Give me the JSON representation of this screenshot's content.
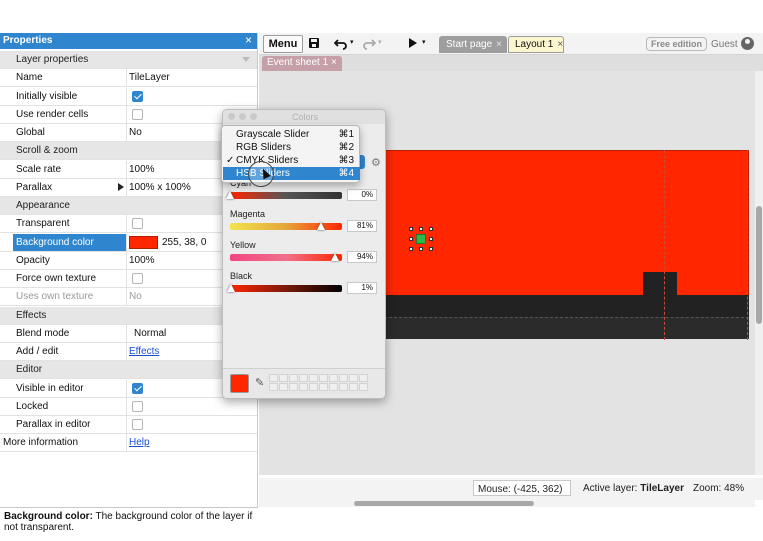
{
  "properties": {
    "title": "Properties",
    "close_label": "×",
    "rows": [
      {
        "type": "section",
        "label": "Layer properties"
      },
      {
        "type": "text",
        "label": "Name",
        "value": "TileLayer"
      },
      {
        "type": "check",
        "label": "Initially visible",
        "checked": true
      },
      {
        "type": "check",
        "label": "Use render cells",
        "checked": false
      },
      {
        "type": "text",
        "label": "Global",
        "value": "No"
      },
      {
        "type": "section",
        "label": "Scroll & zoom"
      },
      {
        "type": "text",
        "label": "Scale rate",
        "value": "100%"
      },
      {
        "type": "text",
        "label": "Parallax",
        "value": "100% x 100%"
      },
      {
        "type": "section",
        "label": "Appearance"
      },
      {
        "type": "check",
        "label": "Transparent",
        "checked": false
      },
      {
        "type": "color",
        "label": "Background color",
        "value": "255, 38, 0"
      },
      {
        "type": "text",
        "label": "Opacity",
        "value": "100%"
      },
      {
        "type": "check",
        "label": "Force own texture",
        "checked": false
      },
      {
        "type": "text",
        "label": "Uses own texture",
        "value": "No"
      },
      {
        "type": "section",
        "label": "Effects"
      },
      {
        "type": "text",
        "label": "Blend mode",
        "value": "Normal"
      },
      {
        "type": "link",
        "label": "Add / edit",
        "value": "Effects"
      },
      {
        "type": "section",
        "label": "Editor"
      },
      {
        "type": "check",
        "label": "Visible in editor",
        "checked": true
      },
      {
        "type": "check",
        "label": "Locked",
        "checked": false
      },
      {
        "type": "check",
        "label": "Parallax in editor",
        "checked": false
      },
      {
        "type": "link",
        "label": "More information",
        "value": "Help"
      }
    ],
    "footer_title": "Background color:",
    "footer_text": " The background color of the layer if not transparent."
  },
  "toolbar": {
    "menu_label": "Menu",
    "tabs": [
      {
        "label": "Start page",
        "close": "×"
      },
      {
        "label": "Layout 1",
        "close": "×"
      }
    ],
    "free_edition_label": "Free edition",
    "user_label": "Guest"
  },
  "subtabs": [
    {
      "label": "Event sheet 1",
      "close": "×"
    }
  ],
  "colors_panel": {
    "title": "Colors",
    "sliders": [
      {
        "label": "Cyan",
        "value": "0%",
        "fraction": 0.0,
        "gradient": "linear-gradient(to right, #ff2600, #555, #333)"
      },
      {
        "label": "Magenta",
        "value": "81%",
        "fraction": 0.81,
        "gradient": "linear-gradient(to right, #f3e34f, #e4a63a, #ff2600)"
      },
      {
        "label": "Yellow",
        "value": "94%",
        "fraction": 0.94,
        "gradient": "linear-gradient(to right, #f24680, #f0708a, #ff2600)"
      },
      {
        "label": "Black",
        "value": "1%",
        "fraction": 0.01,
        "gradient": "linear-gradient(to right, #ff2600, #7a1a0a, #000)"
      }
    ]
  },
  "dropdown": {
    "items": [
      {
        "label": "Grayscale Slider",
        "shortcut": "⌘1",
        "checked": false,
        "highlighted": false
      },
      {
        "label": "RGB Sliders",
        "shortcut": "⌘2",
        "checked": false,
        "highlighted": false
      },
      {
        "label": "CMYK Sliders",
        "shortcut": "⌘3",
        "checked": true,
        "highlighted": false
      },
      {
        "label": "HSB Sliders",
        "shortcut": "⌘4",
        "checked": false,
        "highlighted": true
      }
    ],
    "check_mark": "✓"
  },
  "status": {
    "mouse": "Mouse: (-425, 362)",
    "active_layer_prefix": "Active layer: ",
    "active_layer": "TileLayer",
    "zoom": "Zoom: 48%"
  },
  "colors": {
    "accent": "#2f86cf",
    "background_color": "#ff2600",
    "layout_dark": "#222222"
  }
}
